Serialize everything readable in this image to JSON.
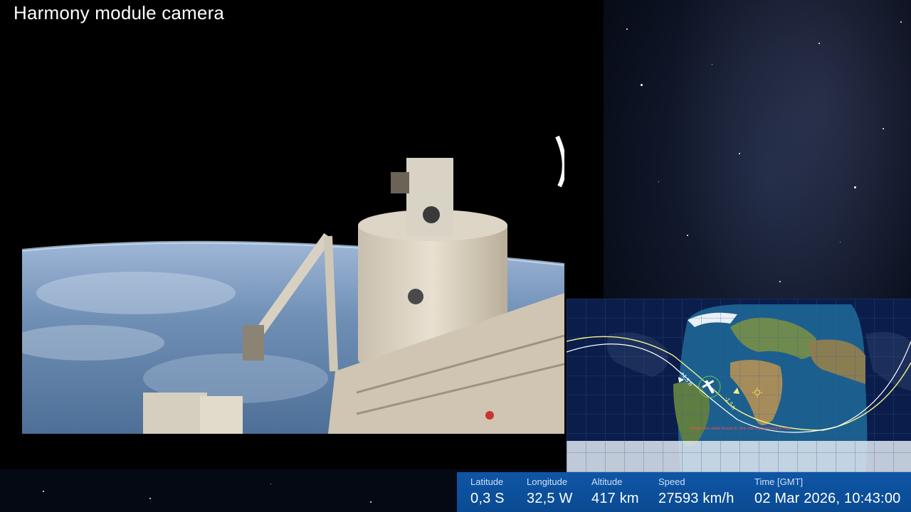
{
  "camera": {
    "title": "Harmony module camera"
  },
  "map": {
    "marker_ahead": "+1,5 h",
    "marker_behind": "-1,5 h",
    "note": "Hidden orbit visible beyond III. Hint: click a ground track in map"
  },
  "telemetry": {
    "latitude": {
      "label": "Latitude",
      "value": "0,3 S"
    },
    "longitude": {
      "label": "Longitude",
      "value": "32,5 W"
    },
    "altitude": {
      "label": "Altitude",
      "value": "417 km"
    },
    "speed": {
      "label": "Speed",
      "value": "27593 km/h"
    },
    "time": {
      "label": "Time [GMT]",
      "value": "02 Mar 2026, 10:43:00"
    }
  },
  "colors": {
    "telemetry_bg": "#0c4f9c",
    "orbit_forward": "#f3f08a",
    "orbit_back": "#ffffff",
    "map_ocean": "#1b5f8e",
    "night_side": "#0b1d4a"
  }
}
